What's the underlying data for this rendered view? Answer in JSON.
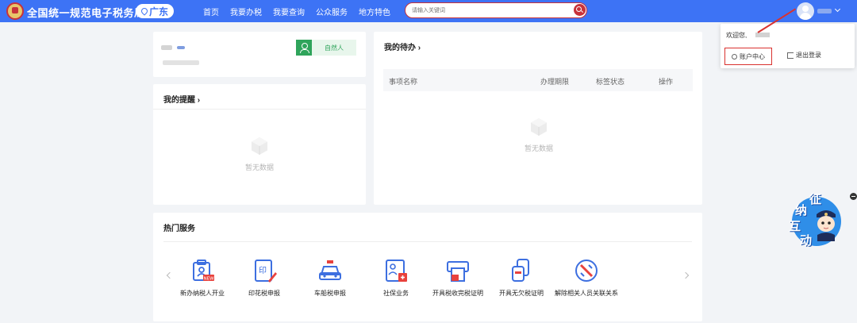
{
  "header": {
    "site_title": "全国统一规范电子税务局",
    "region": "广东",
    "nav": [
      "首页",
      "我要办税",
      "我要查询",
      "公众服务",
      "地方特色"
    ],
    "search_placeholder": "请输入关键词"
  },
  "user_card": {
    "taxpayer_type": "自然人"
  },
  "reminders": {
    "title": "我的提醒 ›",
    "empty": "暂无数据"
  },
  "todo": {
    "title": "我的待办 ›",
    "columns": [
      "事项名称",
      "办理期限",
      "标签状态",
      "操作"
    ],
    "empty": "暂无数据"
  },
  "hot_services": {
    "title": "热门服务",
    "items": [
      {
        "label": "新办纳税人开业",
        "icon": "new-taxpayer-icon"
      },
      {
        "label": "印花税申报",
        "icon": "stamp-tax-icon"
      },
      {
        "label": "车船税申报",
        "icon": "vehicle-tax-icon"
      },
      {
        "label": "社保业务",
        "icon": "social-security-icon"
      },
      {
        "label": "开具税收完税证明",
        "icon": "tax-certificate-icon"
      },
      {
        "label": "开具无欠税证明",
        "icon": "no-arrears-icon"
      },
      {
        "label": "解除相关人员关联关系",
        "icon": "unlink-icon"
      }
    ]
  },
  "dropdown": {
    "welcome": "欢迎您,",
    "account_center": "账户中心",
    "logout": "退出登录"
  },
  "float_widget": {
    "chars": [
      "征",
      "纳",
      "互",
      "动"
    ]
  },
  "colors": {
    "header_blue": "#3d73f5",
    "accent_red": "#c8323a",
    "green": "#2fa45b",
    "icon_blue": "#3d6fe0"
  }
}
